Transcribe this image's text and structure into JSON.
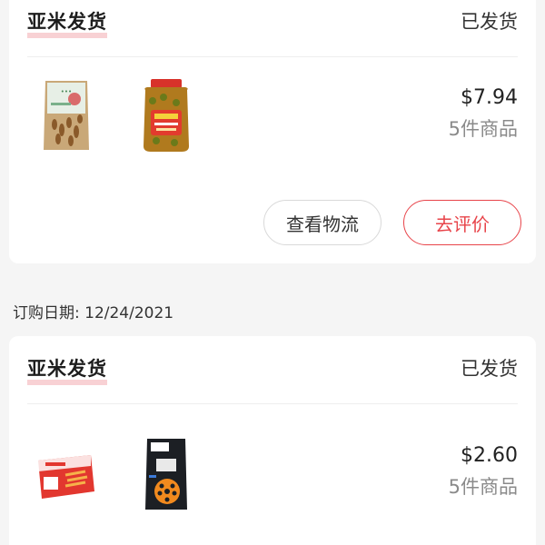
{
  "orders": [
    {
      "seller": "亚米发货",
      "status": "已发货",
      "products": [
        {
          "icon": "peanut-snack-bag-icon"
        },
        {
          "icon": "pickled-vegetable-jar-icon"
        }
      ],
      "price": "$7.94",
      "count": "5件商品",
      "actions": {
        "logistics": "查看物流",
        "review": "去评价"
      }
    },
    {
      "date_label": "订购日期: 12/24/2021",
      "seller": "亚米发货",
      "status": "已发货",
      "products": [
        {
          "icon": "konjac-snack-box-icon"
        },
        {
          "icon": "lotus-root-snack-bag-icon"
        }
      ],
      "price": "$2.60",
      "count": "5件商品"
    }
  ],
  "colors": {
    "accent": "#e8444a",
    "seller_underline": "#f7c9cc",
    "background": "#f5f5f5"
  }
}
